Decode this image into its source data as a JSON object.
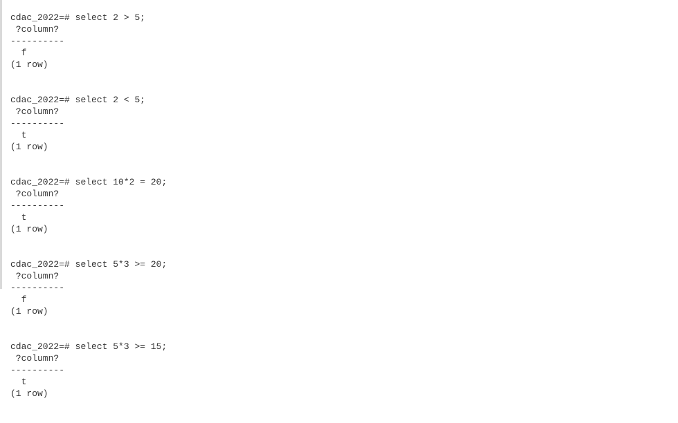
{
  "terminal": {
    "entries": [
      {
        "prompt": "cdac_2022=#",
        "command": "select 2 > 5;",
        "header": " ?column?",
        "separator": "----------",
        "value": "  f",
        "footer": "(1 row)"
      },
      {
        "prompt": "cdac_2022=#",
        "command": "select 2 < 5;",
        "header": " ?column?",
        "separator": "----------",
        "value": "  t",
        "footer": "(1 row)"
      },
      {
        "prompt": "cdac_2022=#",
        "command": "select 10*2 = 20;",
        "header": " ?column?",
        "separator": "----------",
        "value": "  t",
        "footer": "(1 row)"
      },
      {
        "prompt": "cdac_2022=#",
        "command": "select 5*3 >= 20;",
        "header": " ?column?",
        "separator": "----------",
        "value": "  f",
        "footer": "(1 row)"
      },
      {
        "prompt": "cdac_2022=#",
        "command": "select 5*3 >= 15;",
        "header": " ?column?",
        "separator": "----------",
        "value": "  t",
        "footer": "(1 row)"
      }
    ]
  }
}
